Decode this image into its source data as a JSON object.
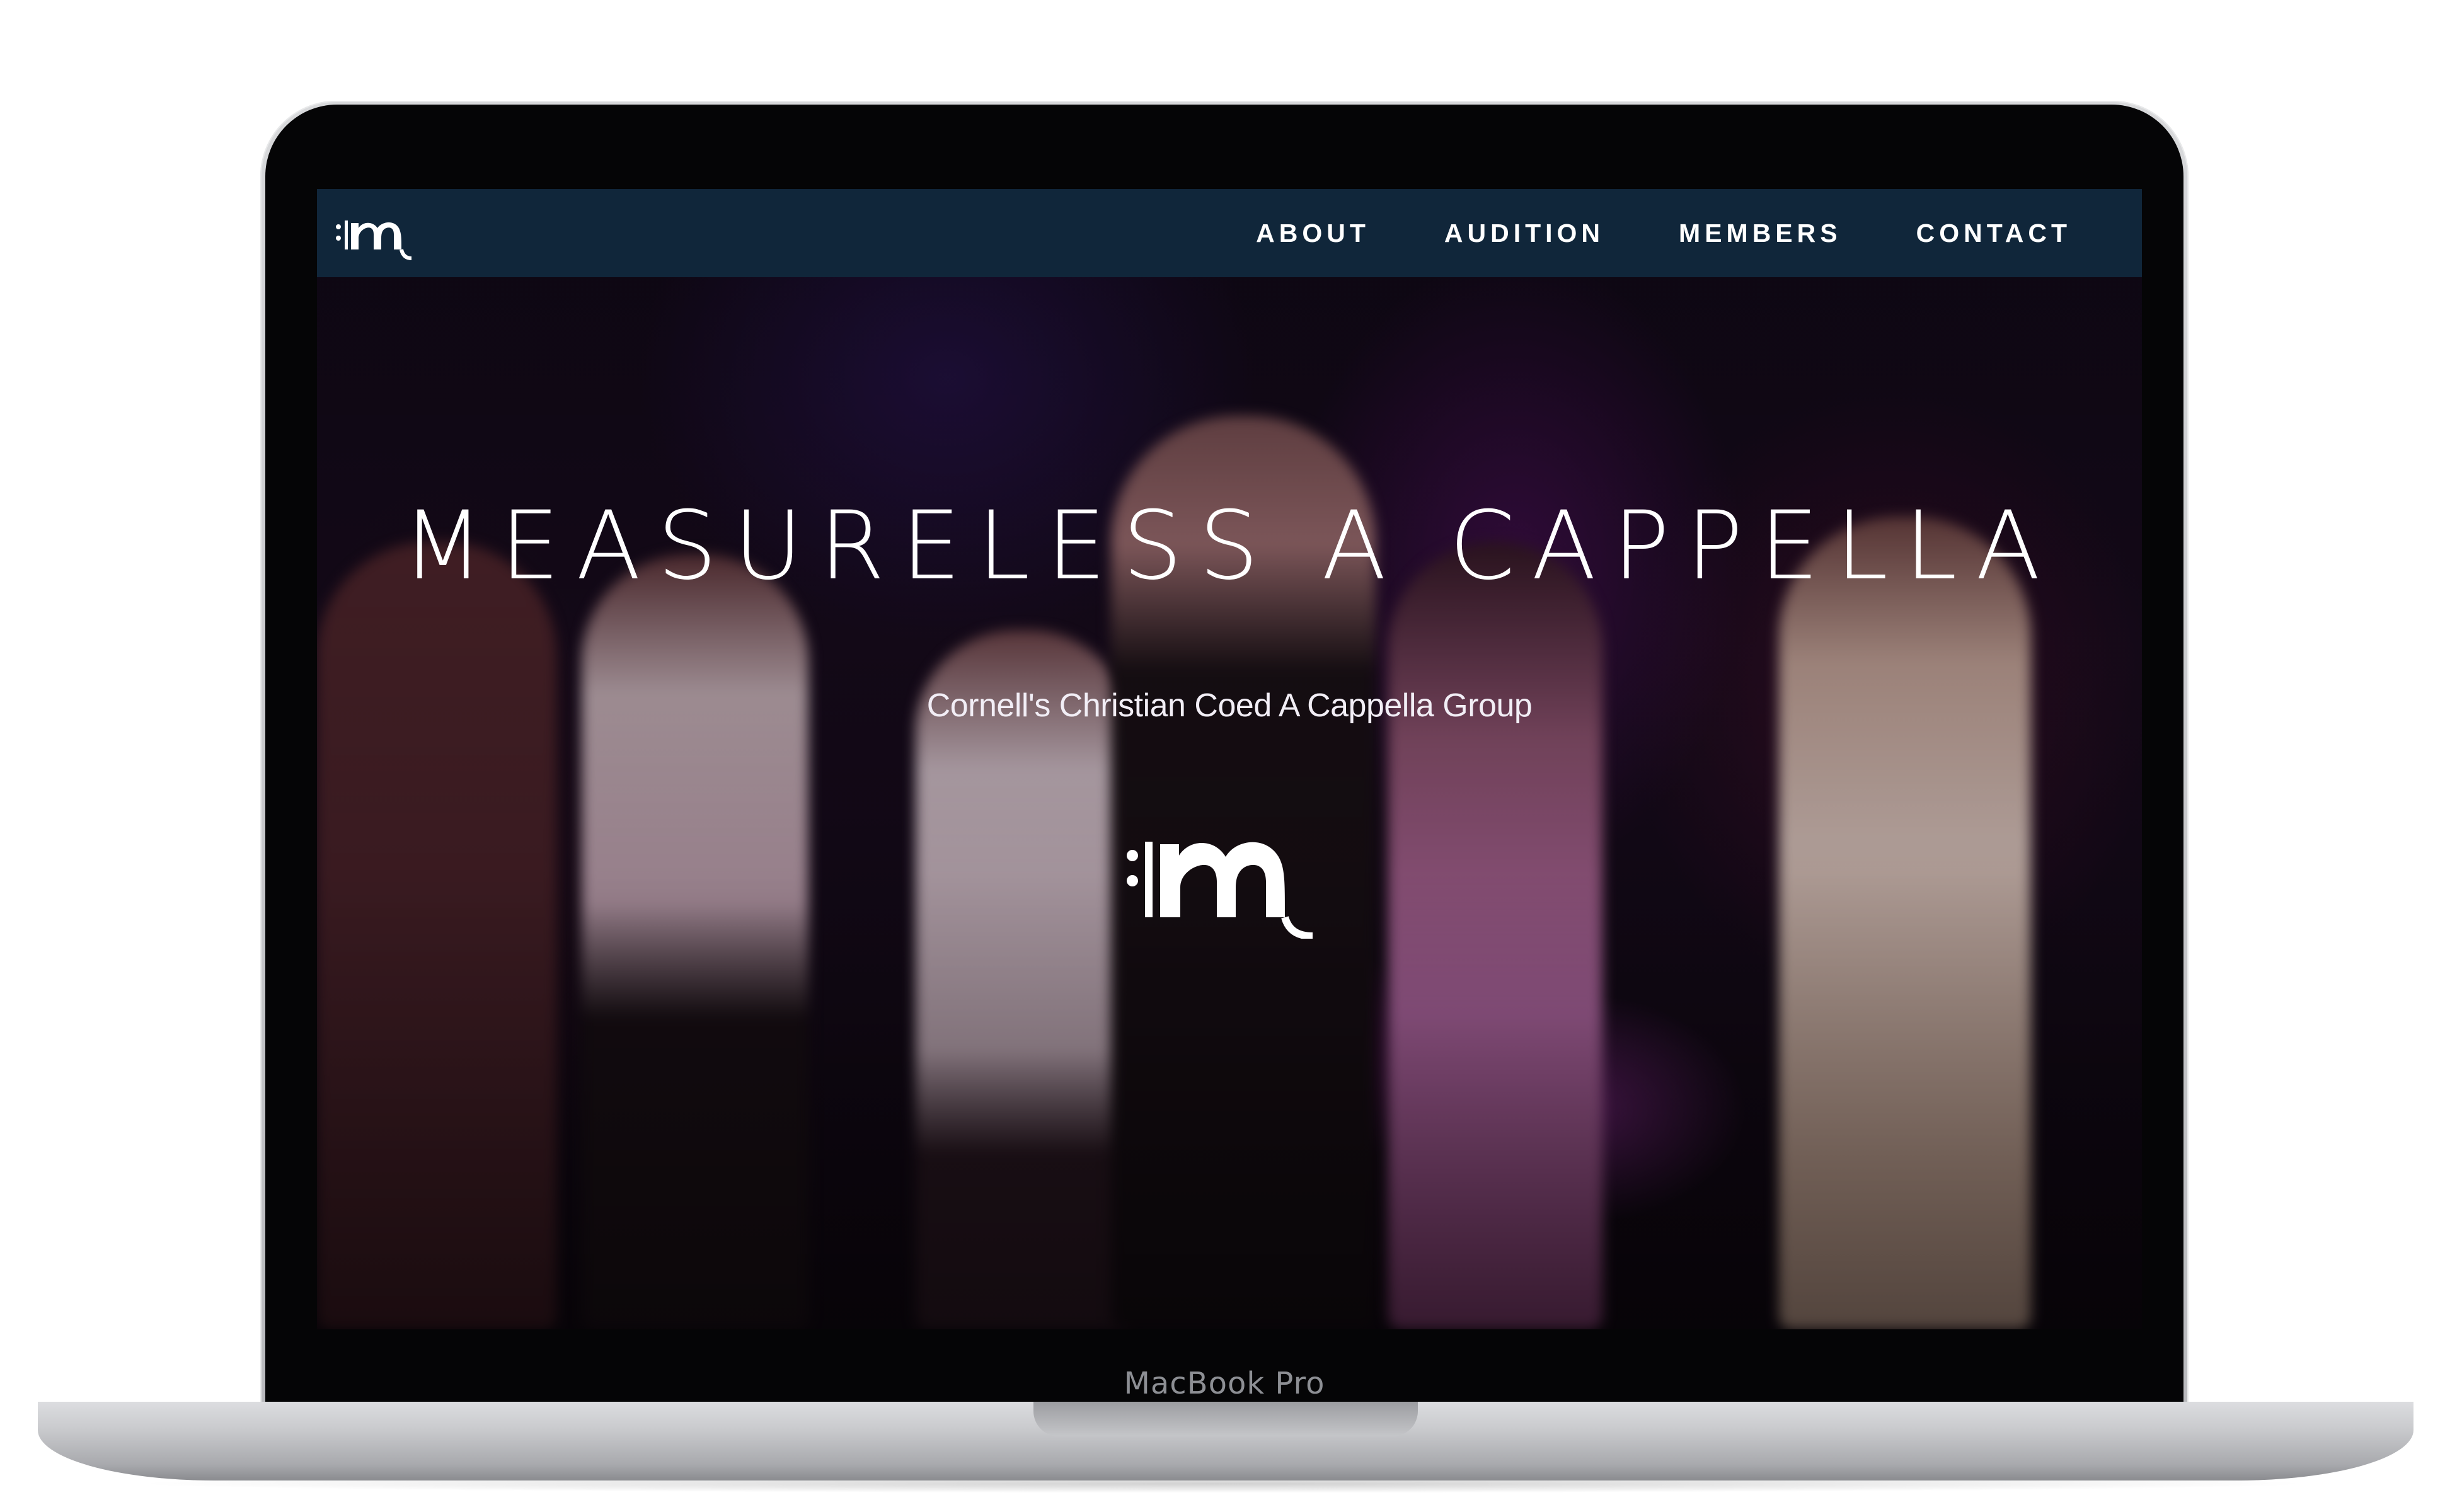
{
  "device": {
    "label": "MacBook Pro"
  },
  "navbar": {
    "logo_icon": "measureless-m-logo",
    "links": [
      {
        "label": "ABOUT"
      },
      {
        "label": "AUDITION"
      },
      {
        "label": "MEMBERS"
      },
      {
        "label": "CONTACT"
      }
    ],
    "background_color": "#10263a"
  },
  "hero": {
    "title": "MEASURELESS A CAPPELLA",
    "subtitle": "Cornell's Christian Coed A Cappella Group",
    "logo_icon": "measureless-m-logo"
  },
  "colors": {
    "accent_stage": "#c62ad0",
    "text": "#ffffff"
  }
}
